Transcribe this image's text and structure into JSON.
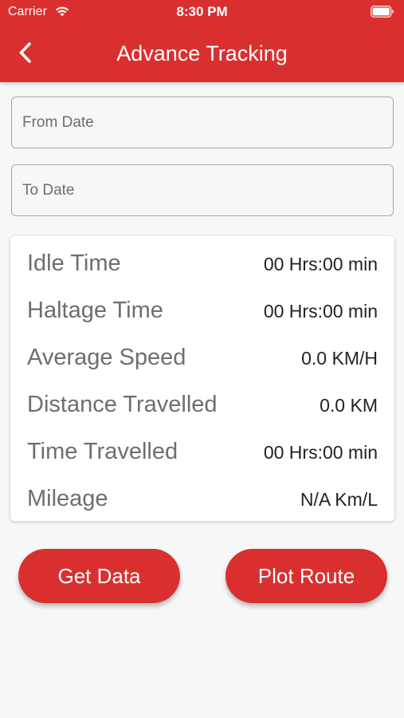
{
  "status_bar": {
    "carrier": "Carrier",
    "time": "8:30 PM",
    "wifi_icon": "wifi-icon",
    "battery_icon": "battery-icon"
  },
  "nav": {
    "title": "Advance Tracking",
    "back_icon": "chevron-left-icon"
  },
  "filters": {
    "from_date": {
      "placeholder": "From Date",
      "value": ""
    },
    "to_date": {
      "placeholder": "To Date",
      "value": ""
    }
  },
  "stats": [
    {
      "label": "Idle Time",
      "value": "00 Hrs:00 min"
    },
    {
      "label": "Haltage Time",
      "value": "00 Hrs:00 min"
    },
    {
      "label": "Average Speed",
      "value": "0.0 KM/H"
    },
    {
      "label": "Distance Travelled",
      "value": "0.0 KM"
    },
    {
      "label": "Time Travelled",
      "value": "00 Hrs:00 min"
    },
    {
      "label": "Mileage",
      "value": "N/A Km/L"
    }
  ],
  "actions": {
    "get_data_label": "Get Data",
    "plot_route_label": "Plot Route"
  },
  "colors": {
    "accent": "#d9302f",
    "background": "#f7f7f7",
    "card": "#ffffff"
  }
}
